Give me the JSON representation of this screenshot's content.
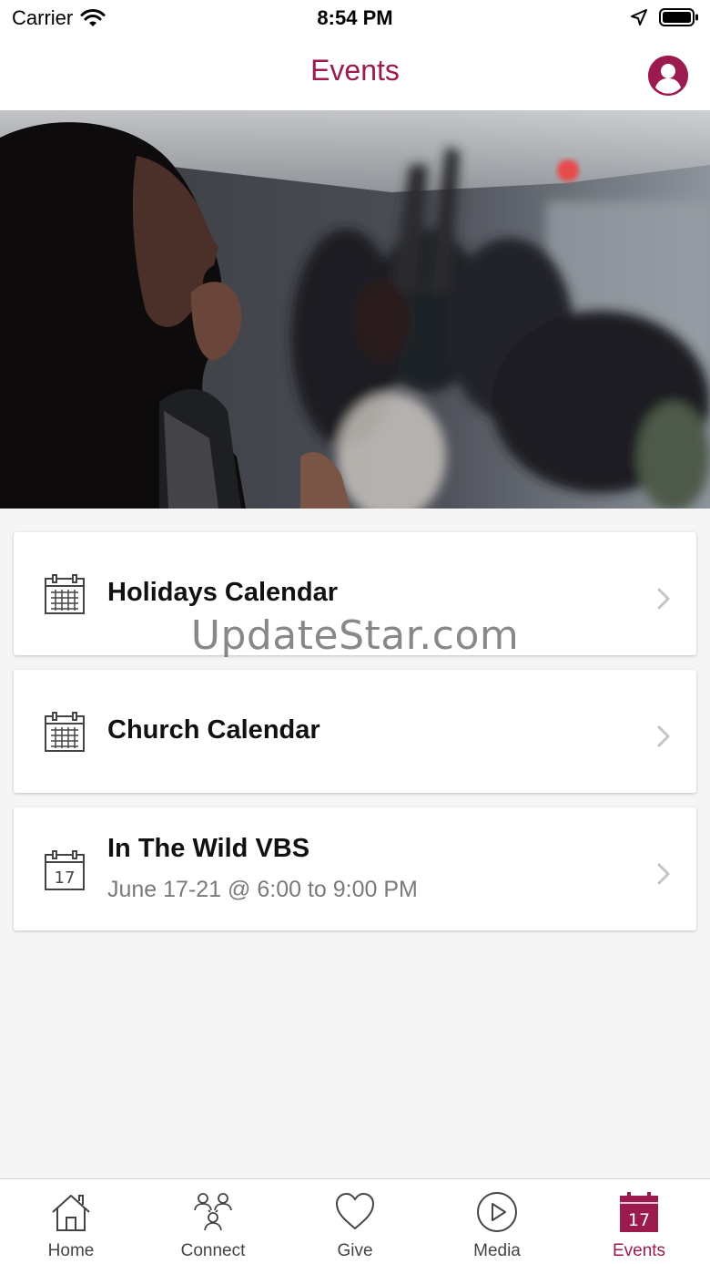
{
  "status_bar": {
    "carrier": "Carrier",
    "time": "8:54 PM"
  },
  "header": {
    "title": "Events",
    "profile_icon": "user-circle-icon",
    "accent_color": "#9b1b4e"
  },
  "hero": {
    "description_icon": "worship-photo"
  },
  "events": [
    {
      "title": "Holidays Calendar",
      "subtitle": "",
      "icon": "calendar-grid-icon"
    },
    {
      "title": "Church Calendar",
      "subtitle": "",
      "icon": "calendar-grid-icon"
    },
    {
      "title": "In The Wild VBS",
      "subtitle": "June 17-21 @ 6:00 to 9:00 PM",
      "icon": "calendar-date-icon",
      "date_badge": "17"
    }
  ],
  "watermark": "UpdateStar.com",
  "tabs": [
    {
      "label": "Home",
      "icon": "home-icon",
      "active": false
    },
    {
      "label": "Connect",
      "icon": "people-icon",
      "active": false
    },
    {
      "label": "Give",
      "icon": "heart-icon",
      "active": false
    },
    {
      "label": "Media",
      "icon": "play-circle-icon",
      "active": false
    },
    {
      "label": "Events",
      "icon": "calendar-icon",
      "active": true,
      "badge": "17"
    }
  ]
}
